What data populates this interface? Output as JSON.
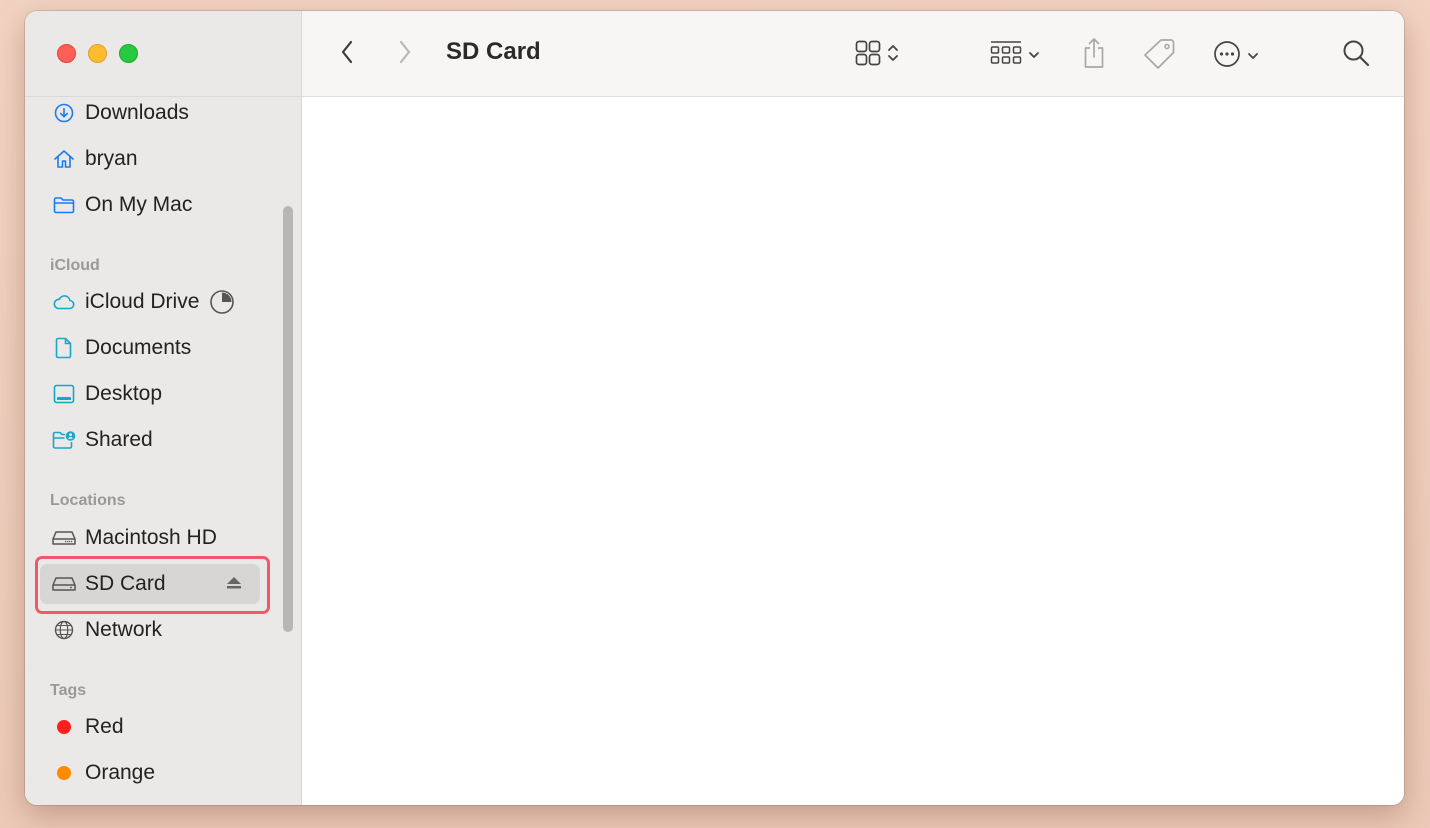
{
  "window": {
    "title": "SD Card"
  },
  "toolbar": {
    "back_icon": "chevron-left-icon",
    "forward_icon": "chevron-right-icon",
    "view_icon": "icon-grid-view-icon",
    "group_icon": "group-icon",
    "share_icon": "share-icon",
    "tag_icon": "tag-icon",
    "more_icon": "ellipsis-circle-icon",
    "search_icon": "search-icon"
  },
  "sidebar": {
    "favorites": [
      {
        "label": "Downloads",
        "icon": "download-circle-icon"
      },
      {
        "label": "bryan",
        "icon": "house-icon"
      },
      {
        "label": "On My Mac",
        "icon": "folder-icon"
      }
    ],
    "icloud_header": "iCloud",
    "icloud": [
      {
        "label": "iCloud Drive",
        "icon": "cloud-icon",
        "status_icon": "sync-pie-icon"
      },
      {
        "label": "Documents",
        "icon": "document-icon"
      },
      {
        "label": "Desktop",
        "icon": "desktop-icon"
      },
      {
        "label": "Shared",
        "icon": "shared-folder-icon"
      }
    ],
    "locations_header": "Locations",
    "locations": [
      {
        "label": "Macintosh HD",
        "icon": "internal-drive-icon"
      },
      {
        "label": "SD Card",
        "icon": "external-drive-icon",
        "selected": true,
        "eject_icon": "eject-icon"
      },
      {
        "label": "Network",
        "icon": "globe-icon"
      }
    ],
    "tags_header": "Tags",
    "tags": [
      {
        "label": "Red",
        "color": "#ff1f1f"
      },
      {
        "label": "Orange",
        "color": "#ff8a00"
      }
    ]
  },
  "colors": {
    "accent": "#1a7cf0",
    "highlight_border": "#ef5a6b"
  }
}
